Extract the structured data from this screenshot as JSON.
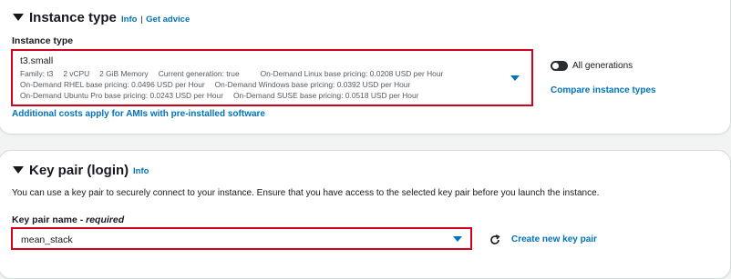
{
  "instance_type": {
    "heading": "Instance type",
    "info": "Info",
    "separator": "|",
    "get_advice": "Get advice",
    "field_label": "Instance type",
    "selected": "t3.small",
    "details_line1": [
      "Family: t3",
      "2 vCPU",
      "2 GiB Memory",
      "Current generation: true",
      "On-Demand Linux base pricing: 0.0208 USD per Hour"
    ],
    "details_line2": [
      "On-Demand RHEL base pricing: 0.0496 USD per Hour",
      "On-Demand Windows base pricing: 0.0392 USD per Hour"
    ],
    "details_line3": [
      "On-Demand Ubuntu Pro base pricing: 0.0243 USD per Hour",
      "On-Demand SUSE base pricing: 0.0518 USD per Hour"
    ],
    "all_generations": "All generations",
    "compare": "Compare instance types",
    "additional_costs": "Additional costs apply for AMIs with pre-installed software"
  },
  "key_pair": {
    "heading": "Key pair (login)",
    "info": "Info",
    "description": "You can use a key pair to securely connect to your instance. Ensure that you have access to the selected key pair before you launch the instance.",
    "field_label": "Key pair name -",
    "field_required": "required",
    "selected": "mean_stack",
    "create_new": "Create new key pair"
  },
  "colors": {
    "link": "#0073bb",
    "highlight_border": "#d0021b",
    "text": "#16191f"
  }
}
